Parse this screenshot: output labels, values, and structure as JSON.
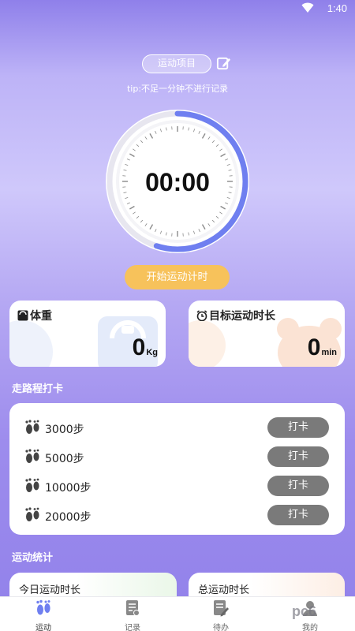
{
  "status_bar": {
    "time": "1:40"
  },
  "header": {
    "project_label": "运动项目",
    "tip": "tip:不足一分钟不进行记录"
  },
  "timer": {
    "display": "00:00",
    "progress_fraction": 0.55
  },
  "start_button": "开始运动计时",
  "cards": {
    "weight": {
      "title": "体重",
      "value": "0",
      "unit": "Kg"
    },
    "goal": {
      "title": "目标运动时长",
      "value": "0",
      "unit": "min"
    }
  },
  "steps_section": {
    "title": "走路程打卡",
    "items": [
      {
        "label": "3000步",
        "button": "打卡"
      },
      {
        "label": "5000步",
        "button": "打卡"
      },
      {
        "label": "10000步",
        "button": "打卡"
      },
      {
        "label": "20000步",
        "button": "打卡"
      }
    ]
  },
  "stats_section": {
    "title": "运动统计",
    "today_label": "今日运动时长",
    "total_label": "总运动时长"
  },
  "tabbar": {
    "tabs": [
      {
        "label": "运动",
        "icon": "footprint-icon",
        "active": true
      },
      {
        "label": "记录",
        "icon": "record-icon",
        "active": false
      },
      {
        "label": "待办",
        "icon": "todo-icon",
        "active": false
      },
      {
        "label": "我的",
        "icon": "profile-icon",
        "active": false
      }
    ]
  },
  "watermark": "pc6",
  "colors": {
    "accent": "#6f7ff0",
    "start_button": "#f7c25b",
    "punch_button": "#7a7a7a"
  }
}
